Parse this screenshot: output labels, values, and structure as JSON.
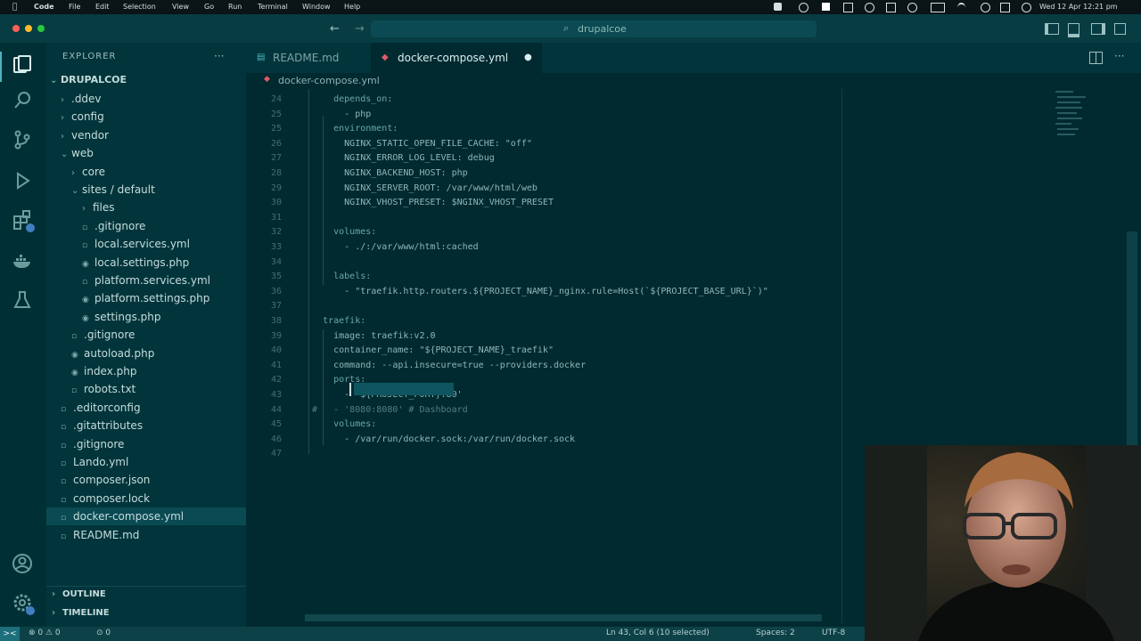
{
  "menubar": {
    "apple": "",
    "app": "Code",
    "items": [
      "File",
      "Edit",
      "Selection",
      "View",
      "Go",
      "Run",
      "Terminal",
      "Window",
      "Help"
    ],
    "clock": "Wed 12 Apr  12:21 pm"
  },
  "titlebar": {
    "search": "drupalcoe",
    "back": "←",
    "forward": "→"
  },
  "activity": {
    "explorer": "explorer-icon",
    "search": "search-icon",
    "source_control": "source-control-icon",
    "run": "run-debug-icon",
    "extensions": "extensions-icon",
    "docker": "docker-icon",
    "testing": "flask-icon",
    "account": "account-icon",
    "settings": "gear-icon"
  },
  "sidebar": {
    "title": "EXPLORER",
    "more": "···",
    "root": "DRUPALCOE",
    "items": [
      {
        "label": ".ddev",
        "type": "folder"
      },
      {
        "label": "config",
        "type": "folder"
      },
      {
        "label": "vendor",
        "type": "folder"
      },
      {
        "label": "web",
        "type": "folder-open"
      },
      {
        "label": "core",
        "type": "folder"
      },
      {
        "label": "sites / default",
        "type": "folder-open"
      },
      {
        "label": "files",
        "type": "folder"
      },
      {
        "label": ".gitignore",
        "type": "file"
      },
      {
        "label": "local.services.yml",
        "type": "file"
      },
      {
        "label": "local.settings.php",
        "type": "php"
      },
      {
        "label": "platform.services.yml",
        "type": "file"
      },
      {
        "label": "platform.settings.php",
        "type": "php"
      },
      {
        "label": "settings.php",
        "type": "php"
      },
      {
        "label": ".gitignore",
        "type": "file"
      },
      {
        "label": "autoload.php",
        "type": "php"
      },
      {
        "label": "index.php",
        "type": "php"
      },
      {
        "label": "robots.txt",
        "type": "file"
      },
      {
        "label": ".editorconfig",
        "type": "file"
      },
      {
        "label": ".gitattributes",
        "type": "file"
      },
      {
        "label": ".gitignore",
        "type": "file"
      },
      {
        "label": "Lando.yml",
        "type": "file"
      },
      {
        "label": "composer.json",
        "type": "file"
      },
      {
        "label": "composer.lock",
        "type": "file"
      },
      {
        "label": "docker-compose.yml",
        "type": "file"
      },
      {
        "label": "README.md",
        "type": "file"
      }
    ],
    "outline": "OUTLINE",
    "timeline": "TIMELINE"
  },
  "tabs": [
    {
      "label": "README.md",
      "icon": "markdown-icon"
    },
    {
      "label": "docker-compose.yml",
      "icon": "yaml-icon",
      "modified": "●"
    }
  ],
  "breadcrumb": "docker-compose.yml",
  "editor": {
    "lines": [
      {
        "n": "24",
        "text": "      depends_on:"
      },
      {
        "n": "25",
        "text": "        - php"
      },
      {
        "n": "25",
        "text": "      environment:"
      },
      {
        "n": "26",
        "text": "        NGINX_STATIC_OPEN_FILE_CACHE: \"off\""
      },
      {
        "n": "27",
        "text": "        NGINX_ERROR_LOG_LEVEL: debug"
      },
      {
        "n": "28",
        "text": "        NGINX_BACKEND_HOST: php"
      },
      {
        "n": "29",
        "text": "        NGINX_SERVER_ROOT: /var/www/html/web"
      },
      {
        "n": "30",
        "text": "        NGINX_VHOST_PRESET: $NGINX_VHOST_PRESET"
      },
      {
        "n": "31",
        "text": ""
      },
      {
        "n": "32",
        "text": "      volumes:"
      },
      {
        "n": "33",
        "text": "        - ./:/var/www/html:cached"
      },
      {
        "n": "34",
        "text": ""
      },
      {
        "n": "35",
        "text": "      labels:"
      },
      {
        "n": "36",
        "text": "        - \"traefik.http.routers.${PROJECT_NAME}_nginx.rule=Host(`${PROJECT_BASE_URL}`)\""
      },
      {
        "n": "37",
        "text": ""
      },
      {
        "n": "38",
        "text": "    traefik:"
      },
      {
        "n": "39",
        "text": "      image: traefik:v2.0"
      },
      {
        "n": "40",
        "text": "      container_name: \"${PROJECT_NAME}_traefik\""
      },
      {
        "n": "41",
        "text": "      command: --api.insecure=true --providers.docker"
      },
      {
        "n": "42",
        "text": "      ports:"
      },
      {
        "n": "43",
        "text": "        - '${PROJECT_PORT}:80'"
      },
      {
        "n": "44",
        "text": "  #   - '8080:8080' # Dashboard"
      },
      {
        "n": "45",
        "text": "      volumes:"
      },
      {
        "n": "46",
        "text": "        - /var/run/docker.sock:/var/run/docker.sock"
      },
      {
        "n": "47",
        "text": ""
      }
    ]
  },
  "statusbar": {
    "remote": "><",
    "problems": "⊗ 0 ⚠ 0",
    "ports": "⊙ 0",
    "position": "Ln 43, Col 6 (10 selected)",
    "spaces": "Spaces: 2",
    "encoding": "UTF-8"
  },
  "colors": {
    "background": "#002a30",
    "sidebar": "#01353b",
    "accent": "#4fb3c0",
    "keyword": "#6aa6a3"
  }
}
